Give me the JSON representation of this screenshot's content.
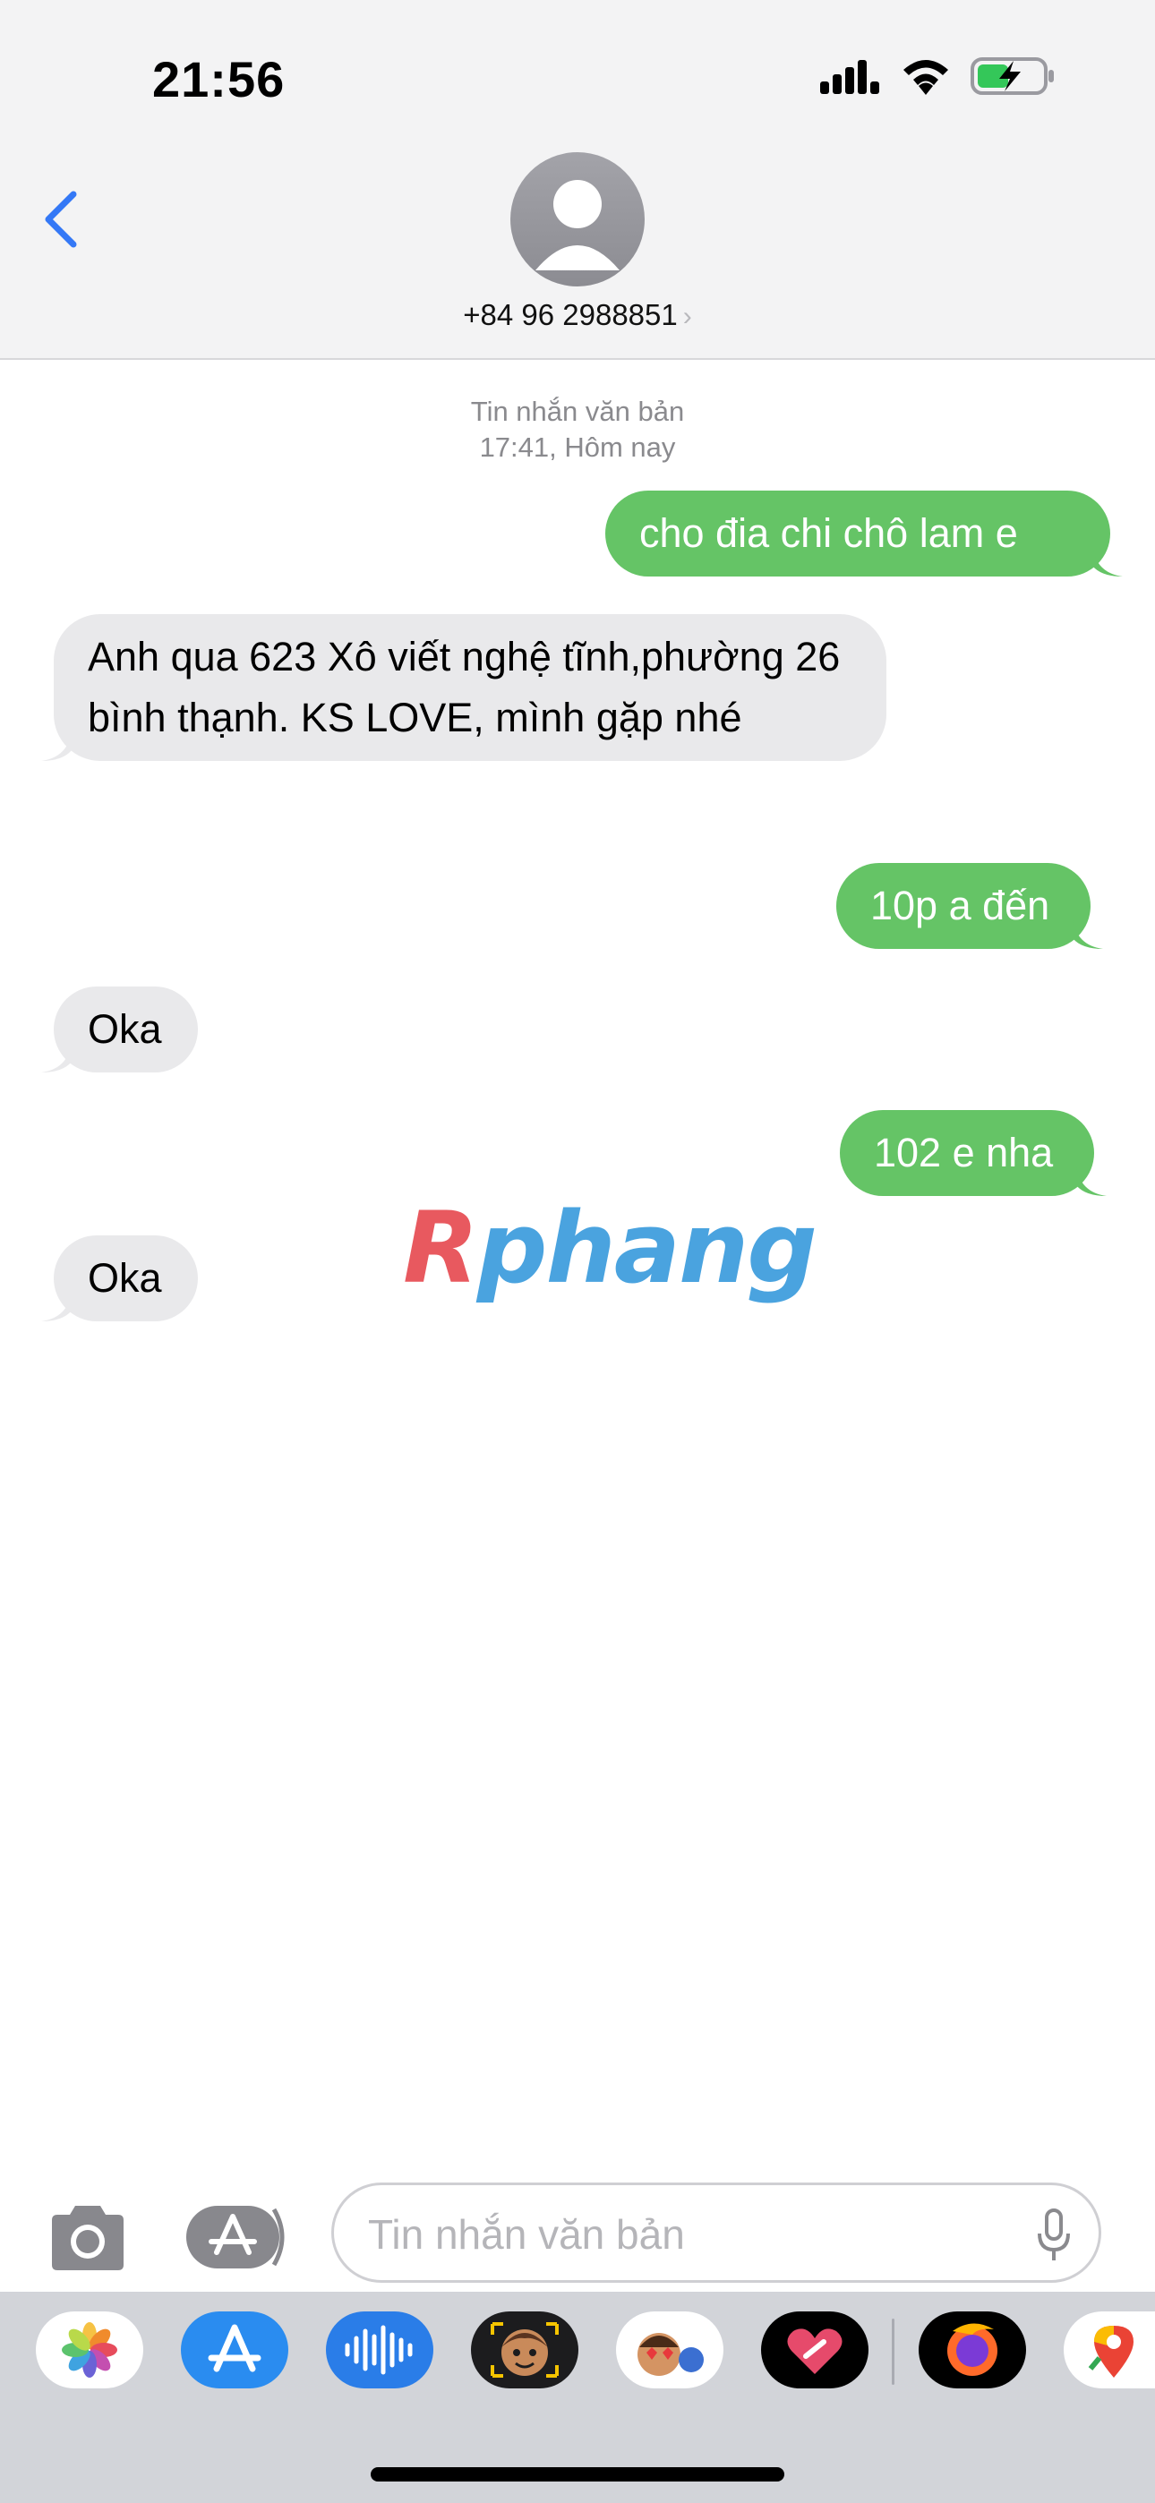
{
  "status_bar": {
    "time": "21:56"
  },
  "header": {
    "contact": "+84 96 2988851",
    "chevron": "›"
  },
  "conversation": {
    "meta_line1": "Tin nhắn văn bản",
    "meta_line2": "17:41, Hôm nay",
    "messages": [
      {
        "direction": "sent",
        "text": "cho đia chi chô lam e"
      },
      {
        "direction": "received",
        "text": "Anh qua 623 Xô viết nghệ tĩnh,phường 26 bình thạnh. KS LOVE, mình gặp nhé"
      },
      {
        "direction": "sent",
        "text": "10p a đến"
      },
      {
        "direction": "received",
        "text": "Oka"
      },
      {
        "direction": "sent",
        "text": "102 e nha"
      },
      {
        "direction": "received",
        "text": "Oka"
      }
    ]
  },
  "watermark": {
    "part1": "R",
    "part2": "phang"
  },
  "input": {
    "placeholder": "Tin nhắn văn bản",
    "value": ""
  },
  "app_drawer": [
    {
      "icon": "photos-app-icon"
    },
    {
      "icon": "app-store-icon"
    },
    {
      "icon": "audio-message-icon"
    },
    {
      "icon": "memoji-camera-icon"
    },
    {
      "icon": "memoji-stickers-icon"
    },
    {
      "icon": "digital-touch-icon"
    },
    {
      "icon": "firefox-icon"
    },
    {
      "icon": "google-maps-icon"
    }
  ],
  "colors": {
    "sent_bubble": "#65c466",
    "received_bubble": "#e9e9eb",
    "accent_blue": "#3478f6"
  }
}
